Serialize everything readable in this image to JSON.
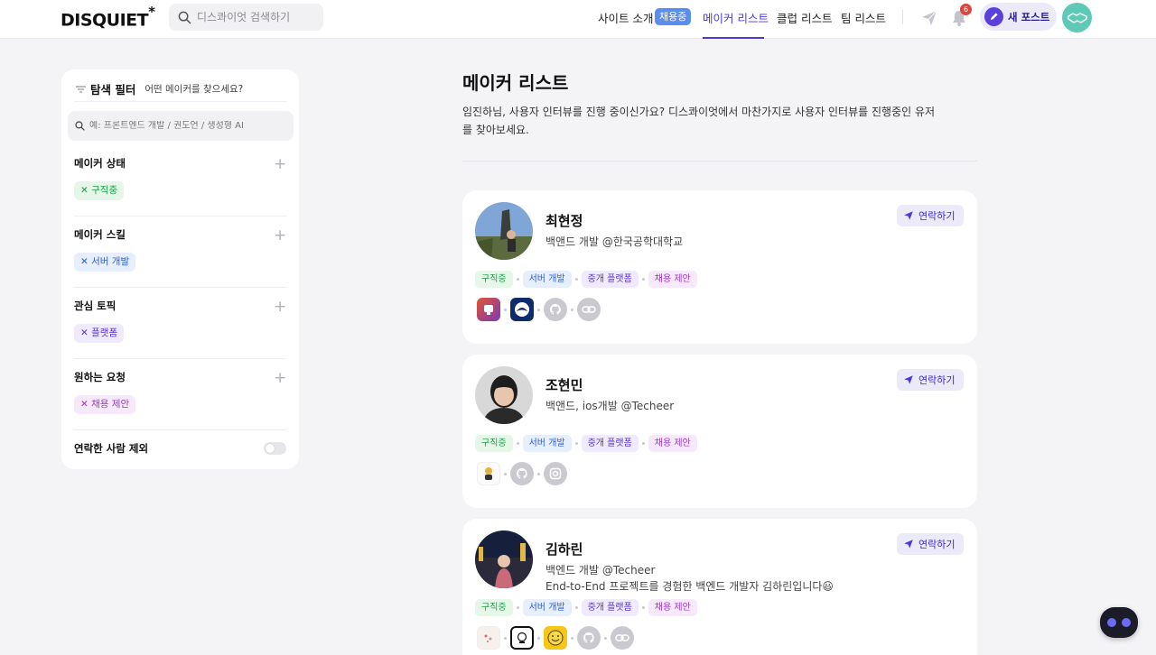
{
  "header": {
    "logo": "DISQUIET",
    "logo_mark": "*",
    "search_placeholder": "디스콰이엇 검색하기",
    "nav": [
      {
        "label": "사이트 소개"
      },
      {
        "label": "메이커 리스트"
      },
      {
        "label": "클럽 리스트"
      },
      {
        "label": "팀 리스트"
      }
    ],
    "nav_badge": "채용중",
    "notification_count": "6",
    "new_post_label": "새 포스트"
  },
  "filter": {
    "title": "탐색 필터",
    "subtitle": "어떤 메이커를 찾으세요?",
    "search_placeholder": "예: 프론트엔드 개발 / 권도언 / 생성형 AI",
    "sections": [
      {
        "title": "메이커 상태",
        "chip": "구직중"
      },
      {
        "title": "메이커 스킬",
        "chip": "서버 개발"
      },
      {
        "title": "관심 토픽",
        "chip": "플랫폼"
      },
      {
        "title": "원하는 요청",
        "chip": "채용 제안"
      }
    ],
    "exclude_label": "연락한 사람 제외"
  },
  "main": {
    "title": "메이커 리스트",
    "description": "임진하님, 사용자 인터뷰를 진행 중이신가요? 디스콰이엇에서 마찬가지로 사용자 인터뷰를 진행중인 유저를 찾아보세요.",
    "contact_label": "연락하기",
    "tags": [
      "구직중",
      "서버 개발",
      "중개 플랫폼",
      "채용 제안"
    ],
    "makers": [
      {
        "name": "최현정",
        "role": "백앤드 개발 @한국공학대학교",
        "intro": ""
      },
      {
        "name": "조현민",
        "role": "백앤드, ios개발 @Techeer",
        "intro": ""
      },
      {
        "name": "김하린",
        "role": "백엔드 개발 @Techeer",
        "intro": "End-to-End 프로젝트를 경험한 백엔드 개발자 김하린입니다😃"
      }
    ]
  },
  "colors": {
    "accent": "#4a3bd6",
    "badge": "#5b8def",
    "tag_green": "#1f9f4a",
    "tag_blue": "#2d5fd6",
    "tag_pink": "#9b3bc0"
  }
}
